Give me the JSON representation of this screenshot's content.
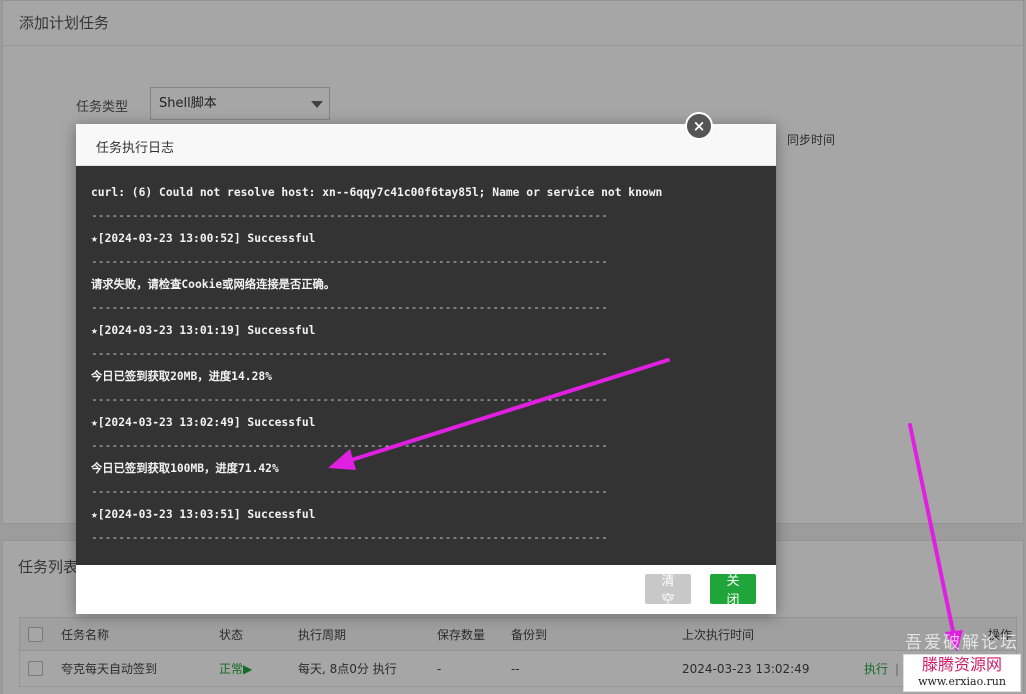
{
  "page": {
    "title": "添加计划任务",
    "task_type_label": "任务类型",
    "task_type_value": "Shell脚本",
    "sync_hint": "同步时间"
  },
  "task_list": {
    "title": "任务列表",
    "columns": [
      "任务名称",
      "状态",
      "执行周期",
      "保存数量",
      "备份到",
      "上次执行时间",
      "操作"
    ],
    "rows": [
      {
        "name": "夸克每天自动签到",
        "status": "正常▶",
        "cycle": "每天, 8点0分 执行",
        "keep": "-",
        "backup": "--",
        "last_run": "2024-03-23 13:02:49",
        "action_exec": "执行",
        "action_sep": "|"
      }
    ]
  },
  "modal": {
    "title": "任务执行日志",
    "close_icon": "×",
    "log_lines": [
      {
        "type": "text",
        "text": "curl: (6) Could not resolve host: xn--6qqy7c41c00f6tay85l; Name or service not known"
      },
      {
        "type": "sep",
        "text": "----------------------------------------------------------------------------"
      },
      {
        "type": "text",
        "text": "★[2024-03-23 13:00:52] Successful"
      },
      {
        "type": "sep",
        "text": "----------------------------------------------------------------------------"
      },
      {
        "type": "text",
        "text": "请求失败，请检查Cookie或网络连接是否正确。"
      },
      {
        "type": "sep",
        "text": "----------------------------------------------------------------------------"
      },
      {
        "type": "text",
        "text": "★[2024-03-23 13:01:19] Successful"
      },
      {
        "type": "sep",
        "text": "----------------------------------------------------------------------------"
      },
      {
        "type": "text",
        "text": "今日已签到获取20MB，进度14.28%"
      },
      {
        "type": "sep",
        "text": "----------------------------------------------------------------------------"
      },
      {
        "type": "text",
        "text": "★[2024-03-23 13:02:49] Successful"
      },
      {
        "type": "sep",
        "text": "----------------------------------------------------------------------------"
      },
      {
        "type": "text",
        "text": "今日已签到获取100MB，进度71.42%"
      },
      {
        "type": "sep",
        "text": "----------------------------------------------------------------------------"
      },
      {
        "type": "text",
        "text": "★[2024-03-23 13:03:51] Successful"
      },
      {
        "type": "sep",
        "text": "----------------------------------------------------------------------------"
      }
    ],
    "btn_clear": "清空",
    "btn_close": "关闭"
  },
  "watermark": {
    "ghost": "吾爱破解论坛",
    "name": "滕腾资源网",
    "url": "www.erxiao.run"
  },
  "colors": {
    "accent_green": "#20a53a",
    "log_bg": "#333333",
    "arrow": "#e020e0"
  }
}
